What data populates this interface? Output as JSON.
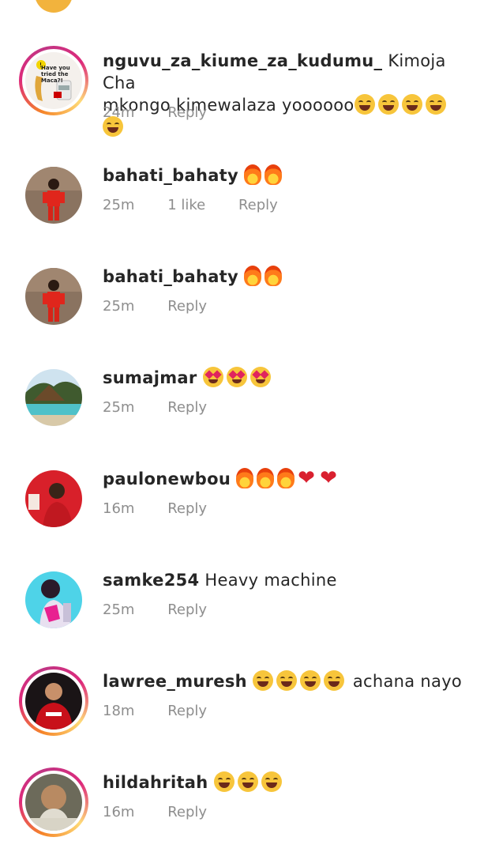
{
  "comments": [
    {
      "username": "nguvu_za_kiume_za_kudumu_",
      "text_line1": "Kimoja Cha",
      "text_line2": "mkongo kimewalaza yoooooo",
      "emojis": [
        "laugh",
        "laugh",
        "laugh",
        "laugh",
        "laugh"
      ],
      "time": "24m",
      "likes": "",
      "reply_label": "Reply",
      "avatar_text": "Have you tried the Maca?!"
    },
    {
      "username": "bahati_bahaty",
      "text": "",
      "emojis": [
        "fire",
        "fire"
      ],
      "time": "25m",
      "likes": "1 like",
      "reply_label": "Reply"
    },
    {
      "username": "bahati_bahaty",
      "text": "",
      "emojis": [
        "fire",
        "fire"
      ],
      "time": "25m",
      "likes": "",
      "reply_label": "Reply"
    },
    {
      "username": "sumajmar",
      "text": "",
      "emojis": [
        "heart-eyes",
        "heart-eyes",
        "heart-eyes"
      ],
      "time": "25m",
      "likes": "",
      "reply_label": "Reply"
    },
    {
      "username": "paulonewbou",
      "text": "",
      "emojis": [
        "fire",
        "fire",
        "fire",
        "heart",
        "heart"
      ],
      "time": "16m",
      "likes": "",
      "reply_label": "Reply"
    },
    {
      "username": "samke254",
      "text": "Heavy machine",
      "emojis": [],
      "time": "25m",
      "likes": "",
      "reply_label": "Reply"
    },
    {
      "username": "lawree_muresh",
      "text_after": "achana nayo",
      "emojis": [
        "laugh",
        "laugh",
        "laugh",
        "laugh"
      ],
      "time": "18m",
      "likes": "",
      "reply_label": "Reply"
    },
    {
      "username": "hildahritah",
      "text": "",
      "emojis": [
        "laugh",
        "laugh",
        "laugh"
      ],
      "time": "16m",
      "likes": "",
      "reply_label": "Reply"
    }
  ]
}
